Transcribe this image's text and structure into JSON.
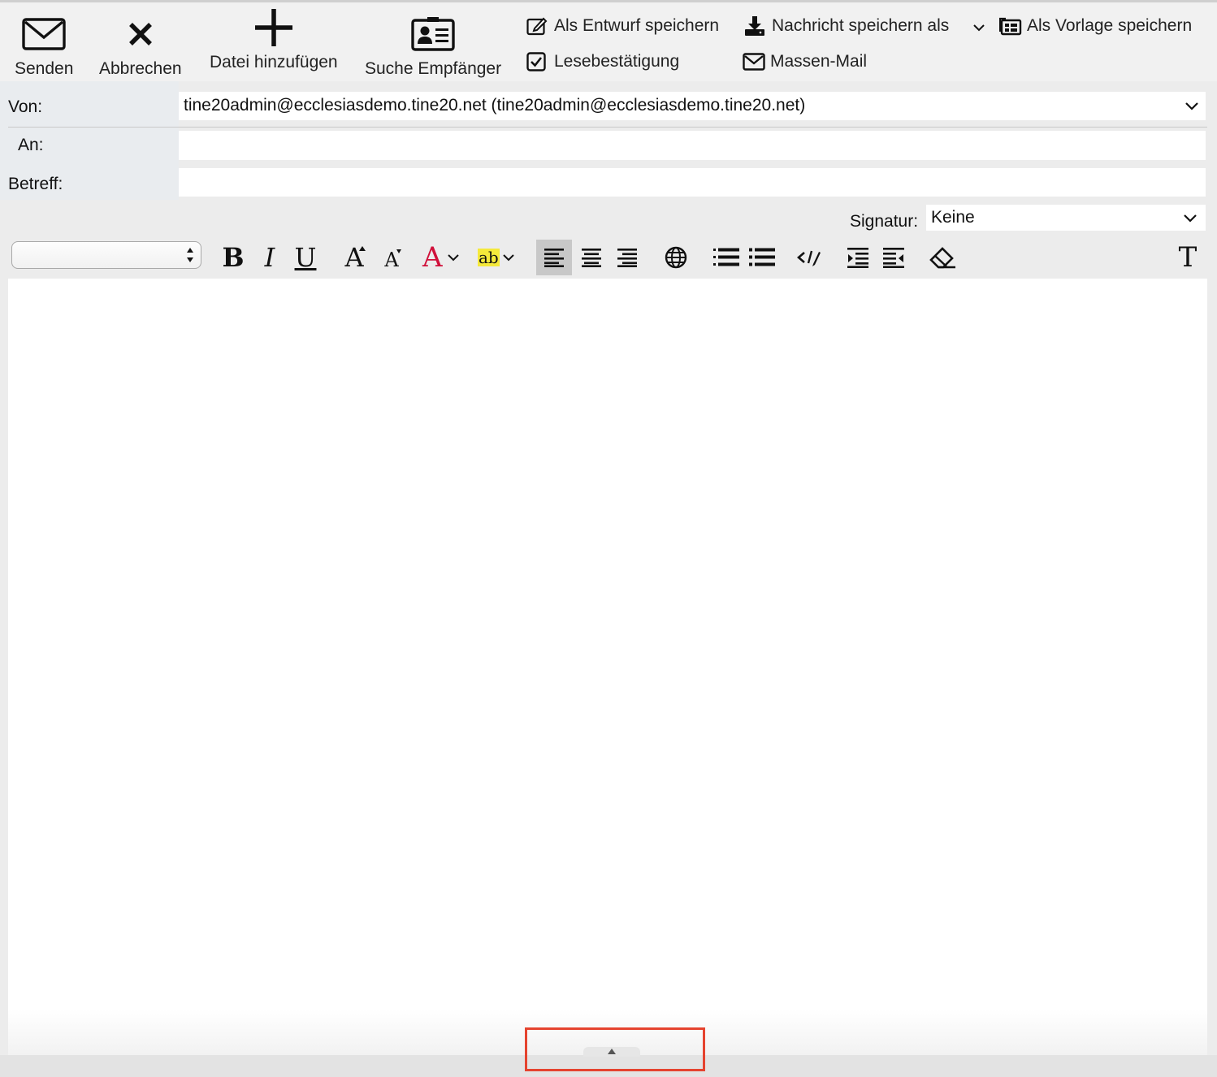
{
  "toolbar": {
    "send": {
      "label": "Senden",
      "icon": "envelope-icon"
    },
    "cancel": {
      "label": "Abbrechen",
      "icon": "close-icon"
    },
    "attach": {
      "label": "Datei hinzufügen",
      "icon": "plus-icon"
    },
    "recipients": {
      "label": "Suche Empfänger",
      "icon": "contact-card-icon"
    },
    "save_draft": {
      "label": "Als Entwurf speichern",
      "icon": "edit-document-icon"
    },
    "save_message_as": {
      "label": "Nachricht speichern als",
      "icon": "download-icon"
    },
    "save_template": {
      "label": "Als Vorlage speichern",
      "icon": "template-icon"
    },
    "read_receipt": {
      "label": "Lesebestätigung",
      "icon": "checkbox-icon",
      "checked": true
    },
    "mass_mail": {
      "label": "Massen-Mail",
      "icon": "envelope-icon"
    }
  },
  "form": {
    "from_label": "Von:",
    "from_value": "tine20admin@ecclesiasdemo.tine20.net (tine20admin@ecclesiasdemo.tine20.net)",
    "to_label": "An:",
    "to_value": "",
    "subject_label": "Betreff:",
    "subject_value": ""
  },
  "editor": {
    "signature_label": "Signatur:",
    "signature_value": "Keine",
    "font_value": "",
    "buttons": {
      "bold": "B",
      "italic": "I",
      "underline": "U",
      "grow_font": "A",
      "shrink_font": "A",
      "font_color": "A",
      "highlight": "ab",
      "plain_text": "T"
    },
    "colors": {
      "font_color": "#d0103a",
      "highlight": "#f5e93b",
      "active_button": "#c8c8c8",
      "highlight_box": "#e5432f"
    },
    "body": ""
  }
}
